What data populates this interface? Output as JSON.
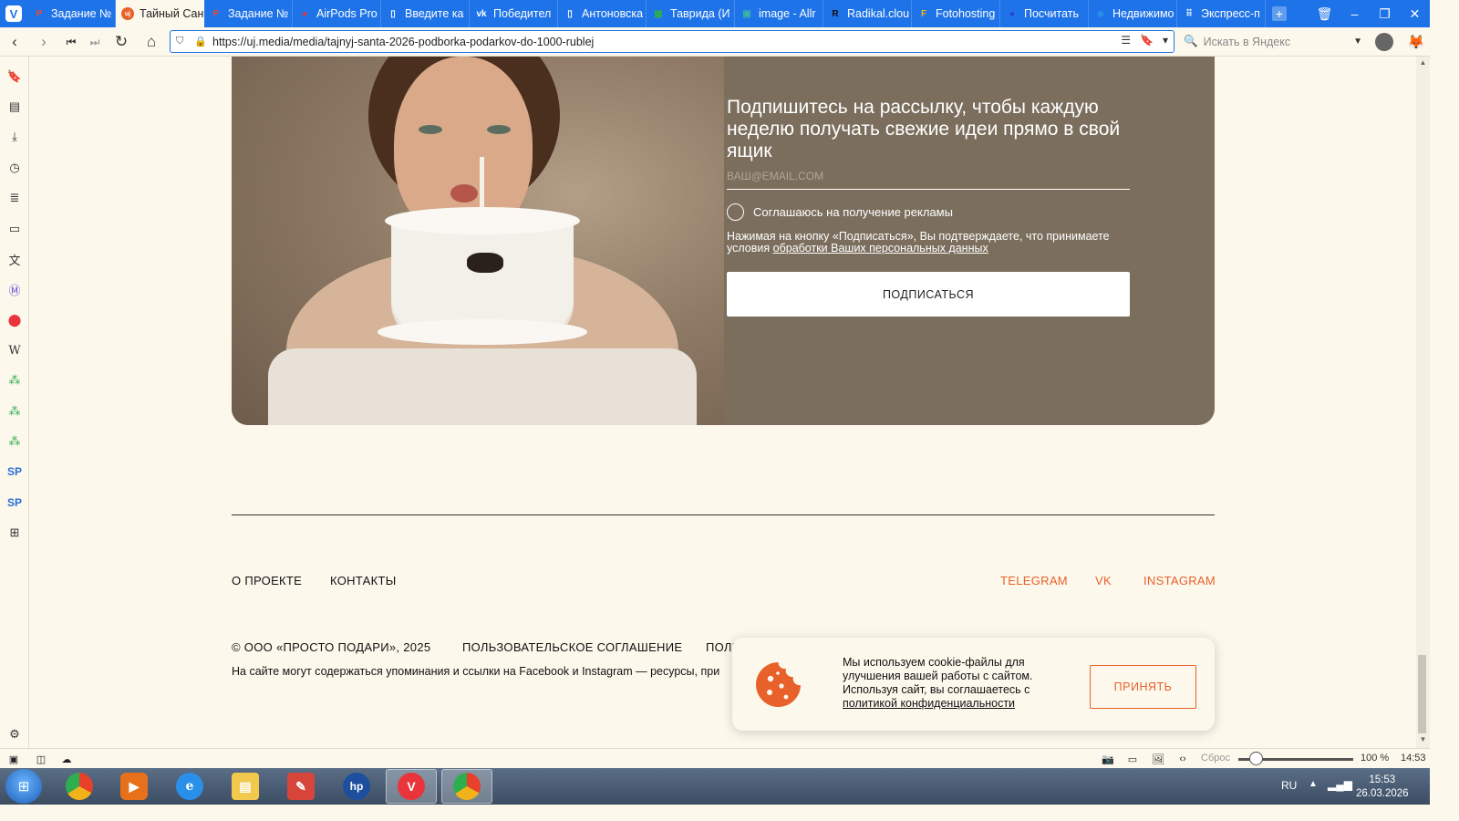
{
  "tabs": [
    {
      "title": "Задание №",
      "icon": "p-icon",
      "color": "#e84a3a",
      "active": false
    },
    {
      "title": "Тайный Сан",
      "icon": "uj-logo-icon",
      "color": "#e8602a",
      "active": true
    },
    {
      "title": "Задание №",
      "icon": "p-icon",
      "color": "#e84a3a",
      "active": false
    },
    {
      "title": "AirPods Pro",
      "icon": "record-icon",
      "color": "#e8343a",
      "active": false
    },
    {
      "title": "Введите ка",
      "icon": "document-icon",
      "color": "#ffffff",
      "active": false
    },
    {
      "title": "Победител",
      "icon": "vk-icon",
      "color": "#ffffff",
      "active": false
    },
    {
      "title": "Антоновска",
      "icon": "document-icon",
      "color": "#ffffff",
      "active": false
    },
    {
      "title": "Таврида (И",
      "icon": "sheet-icon",
      "color": "#2fae4f",
      "active": false
    },
    {
      "title": "image - Allr",
      "icon": "image-icon",
      "color": "#3ab7a0",
      "active": false
    },
    {
      "title": "Radikal.clou",
      "icon": "r-icon",
      "color": "#111111",
      "active": false
    },
    {
      "title": "Fotohosting",
      "icon": "f-icon",
      "color": "#f2b21a",
      "active": false
    },
    {
      "title": "Посчитать",
      "icon": "circle-icon",
      "color": "#2b3fd6",
      "active": false
    },
    {
      "title": "Недвижимо",
      "icon": "diamond-icon",
      "color": "#2a8fe8",
      "active": false
    },
    {
      "title": "Экспресс-п",
      "icon": "grid-icon",
      "color": "#ffffff",
      "active": false
    }
  ],
  "address_bar": {
    "url": "https://uj.media/media/tajnyj-santa-2026-podborka-podarkov-do-1000-rublej",
    "search_placeholder": "Искать в Яндекс"
  },
  "promo": {
    "title": "Подпишитесь на рассылку, чтобы каждую неделю получать свежие идеи прямо в свой ящик",
    "email_placeholder": "ВАШ@EMAIL.COM",
    "consent_label": "Соглашаюсь на получение рекламы",
    "terms_text": "Нажимая на кнопку «Подписаться», Вы подтверждаете, что принимаете условия",
    "terms_link": "обработки Ваших персональных данных",
    "subscribe_label": "ПОДПИСАТЬСЯ"
  },
  "footer": {
    "nav": [
      "О ПРОЕКТЕ",
      "КОНТАКТЫ"
    ],
    "social": [
      "TELEGRAM",
      "VK",
      "INSTAGRAM"
    ],
    "copyright": "© ООО «ПРОСТО ПОДАРИ», 2025",
    "agreement": "ПОЛЬЗОВАТЕЛЬСКОЕ СОГЛАШЕНИЕ",
    "policy_partial": "ПОЛИ",
    "disclaimer": "На сайте могут содержаться упоминания и ссылки на Facebook и Instagram — ресурсы, при"
  },
  "cookie": {
    "text": "Мы используем cookie-файлы для улучшения вашей работы с сайтом. Используя сайт, вы соглашаетесь с",
    "link": "политикой конфиденциальности",
    "accept_label": "ПРИНЯТЬ"
  },
  "status": {
    "zoom_reset_label": "Сброс",
    "zoom": "100 %",
    "zoom_level": 0.15,
    "time": "14:53"
  },
  "taskbar": {
    "lang": "RU",
    "clock_time": "15:53",
    "clock_date": "26.03.2026"
  },
  "colors": {
    "accent": "#e8602a",
    "browser_blue": "#1e73e8",
    "page_bg": "#fdf8ec",
    "promo_bg": "#7b6e5d"
  }
}
